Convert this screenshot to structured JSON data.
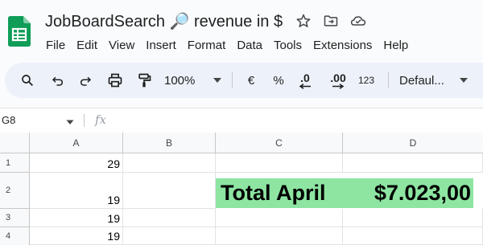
{
  "app": {
    "doc_title": "JobBoardSearch 🔎 revenue in $",
    "icons": [
      "sheets-logo",
      "star-icon",
      "move-folder-icon",
      "cloud-status-icon"
    ],
    "brand_color": "#0f9d58"
  },
  "menu": {
    "items": [
      "File",
      "Edit",
      "View",
      "Insert",
      "Format",
      "Data",
      "Tools",
      "Extensions",
      "Help"
    ]
  },
  "toolbar": {
    "zoom": "100%",
    "currency": "€",
    "percent": "%",
    "decrease_decimal": ".0",
    "increase_decimal": ".00",
    "more_formats": "123",
    "font": "Defaul..."
  },
  "formula_bar": {
    "name_box": "G8",
    "fx": "fx",
    "formula": ""
  },
  "grid": {
    "columns": [
      "A",
      "B",
      "C",
      "D"
    ],
    "rows": [
      "1",
      "2",
      "3",
      "4"
    ],
    "cells": {
      "A1": "29",
      "A2": "19",
      "A3": "19",
      "A4": "19",
      "C2": "Total April",
      "D2": "$7.023,00"
    },
    "highlight_color": "#8de5a1"
  }
}
